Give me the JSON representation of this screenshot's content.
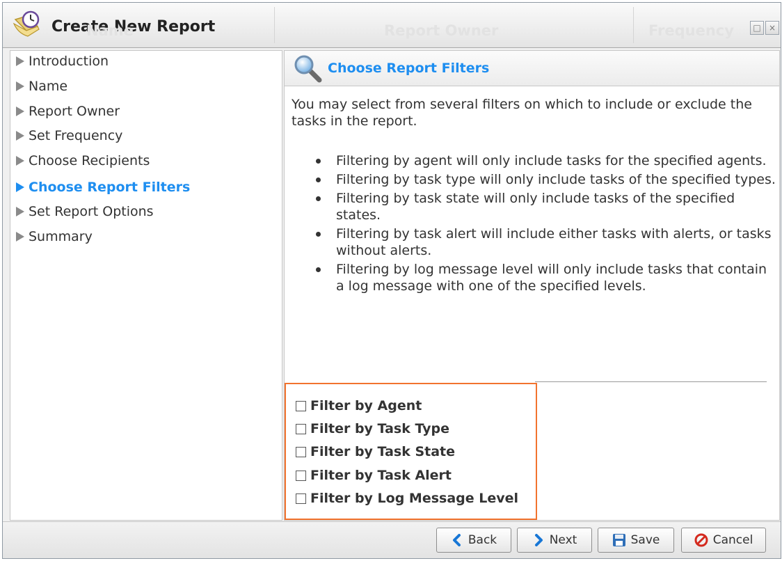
{
  "window": {
    "title": "Create New Report",
    "background_tabs": [
      "Name",
      "Report Owner",
      "Frequency"
    ]
  },
  "nav": {
    "items": [
      {
        "label": "Introduction",
        "active": false
      },
      {
        "label": "Name",
        "active": false
      },
      {
        "label": "Report Owner",
        "active": false
      },
      {
        "label": "Set Frequency",
        "active": false
      },
      {
        "label": "Choose Recipients",
        "active": false
      },
      {
        "label": "Choose Report Filters",
        "active": true
      },
      {
        "label": "Set Report Options",
        "active": false
      },
      {
        "label": "Summary",
        "active": false
      }
    ]
  },
  "main": {
    "title": "Choose Report Filters",
    "intro": "You may select from several filters on which to include or exclude the tasks in the report.",
    "bullets": [
      "Filtering by agent will only include tasks for the specified agents.",
      "Filtering by task type will only include tasks of the specified types.",
      "Filtering by task state will only include tasks of the specified states.",
      "Filtering by task alert will include either tasks with alerts, or tasks without alerts.",
      "Filtering by log message level will only include tasks that contain a log message with one of the specified levels."
    ],
    "filters": [
      {
        "label": "Filter by Agent",
        "checked": false
      },
      {
        "label": "Filter by Task Type",
        "checked": false
      },
      {
        "label": "Filter by Task State",
        "checked": false
      },
      {
        "label": "Filter by Task Alert",
        "checked": false
      },
      {
        "label": "Filter by Log Message Level",
        "checked": false
      }
    ]
  },
  "footer": {
    "back_label": "Back",
    "next_label": "Next",
    "save_label": "Save",
    "cancel_label": "Cancel"
  },
  "colors": {
    "accent": "#1e8ef0",
    "highlight_border": "#f2732e",
    "cancel_red": "#d42a1e"
  }
}
